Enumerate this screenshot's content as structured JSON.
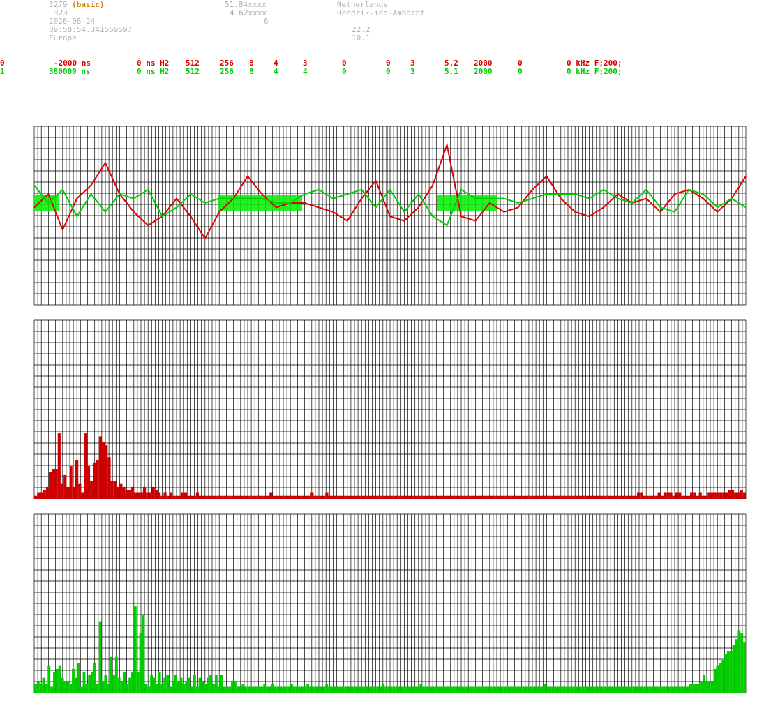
{
  "info": {
    "id": "3279",
    "mode": "(basic)",
    "num": "323",
    "date": "2026-08-24",
    "time": "09:58:54.341569597",
    "region": "Europe",
    "lat": "51.84xxxx",
    "lon": "4.62xxxx",
    "n6": "6",
    "country": "Netherlands",
    "city": "Hendrik-ido-Ambacht",
    "v1": "22.2",
    "v2": "10.1"
  },
  "rows": [
    {
      "color": "#dd0000",
      "cells": [
        "0",
        "-2000 ns",
        "0 ns H2",
        "512",
        "256",
        "8",
        "4",
        "3",
        "0",
        "0",
        "3",
        "5.2",
        "2000",
        "0",
        "0 kHz F;200;"
      ]
    },
    {
      "color": "#00cc00",
      "cells": [
        "1",
        "380000 ns",
        "0 ns H2",
        "512",
        "256",
        "8",
        "4",
        "4",
        "0",
        "0",
        "3",
        "5.1",
        "2000",
        "0",
        "0 kHz F;200;"
      ]
    }
  ],
  "chart_data": [
    {
      "type": "line",
      "series": [
        {
          "color": "#dd0000",
          "x": [
            0,
            2,
            4,
            6,
            8,
            10,
            12,
            14,
            16,
            18,
            20,
            22,
            24,
            26,
            28,
            30,
            32,
            34,
            36,
            38,
            40,
            42,
            44,
            46,
            48,
            50,
            52,
            54,
            56,
            58,
            60,
            62,
            64,
            66,
            68,
            70,
            72,
            74,
            76,
            78,
            80,
            82,
            84,
            86,
            88,
            90,
            92,
            94,
            96,
            98,
            100
          ],
          "y": [
            -0.1,
            0.2,
            -0.6,
            0.1,
            0.4,
            0.9,
            0.2,
            -0.2,
            -0.5,
            -0.3,
            0.1,
            -0.3,
            -0.8,
            -0.2,
            0.1,
            0.6,
            0.2,
            -0.1,
            0,
            0,
            -0.1,
            -0.2,
            -0.4,
            0.1,
            0.5,
            -0.3,
            -0.4,
            -0.1,
            0.4,
            1.3,
            -0.3,
            -0.4,
            0,
            -0.2,
            -0.1,
            0.3,
            0.6,
            0.1,
            -0.2,
            -0.3,
            -0.1,
            0.2,
            0,
            0.1,
            -0.2,
            0.2,
            0.3,
            0.1,
            -0.2,
            0.1,
            0.6
          ]
        },
        {
          "color": "#00cc00",
          "x": [
            0,
            2,
            4,
            6,
            8,
            10,
            12,
            14,
            16,
            18,
            20,
            22,
            24,
            26,
            28,
            30,
            32,
            34,
            36,
            38,
            40,
            42,
            44,
            46,
            48,
            50,
            52,
            54,
            56,
            58,
            60,
            62,
            64,
            66,
            68,
            70,
            72,
            74,
            76,
            78,
            80,
            82,
            84,
            86,
            88,
            90,
            92,
            94,
            96,
            98,
            100
          ],
          "y": [
            0.4,
            0,
            0.3,
            -0.3,
            0.2,
            -0.2,
            0.2,
            0.1,
            0.3,
            -0.3,
            -0.1,
            0.2,
            0,
            0.1,
            0.1,
            0.1,
            0.1,
            0,
            0,
            0.2,
            0.3,
            0.1,
            0.2,
            0.3,
            -0.1,
            0.3,
            -0.2,
            0.2,
            -0.3,
            -0.5,
            0.3,
            0.1,
            0.1,
            0.1,
            0,
            0.1,
            0.2,
            0.2,
            0.2,
            0.1,
            0.3,
            0.1,
            0,
            0.3,
            -0.1,
            -0.2,
            0.3,
            0.2,
            -0.1,
            0.1,
            -0.1
          ]
        }
      ],
      "ylim": [
        -2,
        2
      ]
    },
    {
      "type": "bar",
      "color": "#cc0000",
      "values": [
        1,
        2,
        2,
        3,
        4,
        9,
        10,
        10,
        22,
        5,
        8,
        4,
        11,
        4,
        13,
        5,
        2,
        22,
        11,
        6,
        12,
        13,
        21,
        19,
        18,
        14,
        6,
        6,
        4,
        5,
        4,
        3,
        3,
        4,
        2,
        2,
        2,
        4,
        2,
        2,
        4,
        3,
        2,
        1,
        2,
        1,
        2,
        1,
        1,
        1,
        2,
        2,
        1,
        1,
        1,
        2,
        1,
        1,
        1,
        1,
        1,
        1,
        1,
        1,
        1,
        1,
        1,
        1,
        1,
        1,
        1,
        1,
        1,
        1,
        1,
        1,
        1,
        1,
        1,
        1,
        2,
        1,
        1,
        1,
        1,
        1,
        1,
        1,
        1,
        1,
        1,
        1,
        1,
        1,
        2,
        1,
        1,
        1,
        1,
        2,
        1,
        1,
        1,
        1,
        1,
        1,
        1,
        1,
        1,
        1,
        1,
        1,
        1,
        1,
        1,
        1,
        1,
        1,
        1,
        1,
        1,
        1,
        1,
        1,
        1,
        1,
        1,
        1,
        1,
        1,
        1,
        1,
        1,
        1,
        1,
        1,
        1,
        1,
        1,
        1,
        1,
        1,
        1,
        1,
        1,
        1,
        1,
        1,
        1,
        1,
        1,
        1,
        1,
        1,
        1,
        1,
        1,
        1,
        1,
        1,
        1,
        1,
        1,
        1,
        1,
        1,
        1,
        1,
        1,
        1,
        1,
        1,
        1,
        1,
        1,
        1,
        1,
        1,
        1,
        1,
        1,
        1,
        1,
        1,
        1,
        1,
        1,
        1,
        1,
        1,
        1,
        1,
        1,
        1,
        1,
        1,
        1,
        1,
        1,
        1,
        1,
        1,
        1,
        1,
        1,
        2,
        2,
        1,
        1,
        1,
        1,
        1,
        2,
        1,
        2,
        2,
        2,
        1,
        2,
        2,
        1,
        1,
        1,
        2,
        2,
        1,
        2,
        1,
        1,
        2,
        2,
        2,
        2,
        2,
        2,
        2,
        3,
        3,
        2,
        2,
        3,
        2
      ],
      "ylim": [
        0,
        60
      ]
    },
    {
      "type": "bar",
      "color": "#00cc00",
      "values": [
        3,
        4,
        3,
        5,
        3,
        9,
        2,
        7,
        8,
        9,
        5,
        4,
        4,
        3,
        8,
        5,
        10,
        2,
        7,
        3,
        6,
        7,
        10,
        3,
        24,
        4,
        6,
        3,
        12,
        6,
        12,
        5,
        4,
        7,
        3,
        5,
        7,
        29,
        7,
        20,
        26,
        3,
        2,
        6,
        5,
        3,
        7,
        3,
        5,
        6,
        2,
        4,
        6,
        4,
        5,
        3,
        4,
        5,
        2,
        6,
        2,
        5,
        4,
        3,
        5,
        6,
        3,
        6,
        2,
        6,
        2,
        2,
        2,
        4,
        4,
        2,
        2,
        3,
        2,
        2,
        2,
        2,
        2,
        2,
        2,
        3,
        2,
        2,
        3,
        2,
        2,
        2,
        2,
        2,
        2,
        3,
        2,
        2,
        2,
        2,
        2,
        3,
        2,
        2,
        2,
        2,
        2,
        2,
        3,
        2,
        2,
        2,
        2,
        2,
        2,
        2,
        2,
        2,
        2,
        2,
        2,
        2,
        2,
        2,
        2,
        2,
        2,
        2,
        2,
        3,
        2,
        2,
        2,
        2,
        2,
        2,
        2,
        2,
        2,
        2,
        2,
        2,
        2,
        3,
        2,
        2,
        2,
        2,
        2,
        2,
        2,
        2,
        2,
        2,
        2,
        2,
        2,
        2,
        2,
        2,
        2,
        2,
        2,
        2,
        2,
        2,
        2,
        2,
        2,
        2,
        2,
        2,
        2,
        2,
        2,
        2,
        2,
        2,
        2,
        2,
        2,
        2,
        2,
        2,
        2,
        2,
        2,
        2,
        2,
        3,
        2,
        2,
        2,
        2,
        2,
        2,
        2,
        2,
        2,
        2,
        2,
        2,
        2,
        2,
        2,
        2,
        2,
        2,
        2,
        2,
        2,
        2,
        2,
        2,
        2,
        2,
        2,
        2,
        2,
        2,
        2,
        2,
        2,
        2,
        2,
        2,
        2,
        2,
        2,
        2,
        2,
        2,
        2,
        2,
        2,
        2,
        2,
        2,
        2,
        2,
        2,
        2,
        2,
        3,
        3,
        3,
        3,
        4,
        6,
        4,
        4,
        4,
        8,
        9,
        10,
        11,
        13,
        14,
        14,
        16,
        18,
        21,
        20,
        17
      ],
      "ylim": [
        0,
        60
      ]
    }
  ]
}
